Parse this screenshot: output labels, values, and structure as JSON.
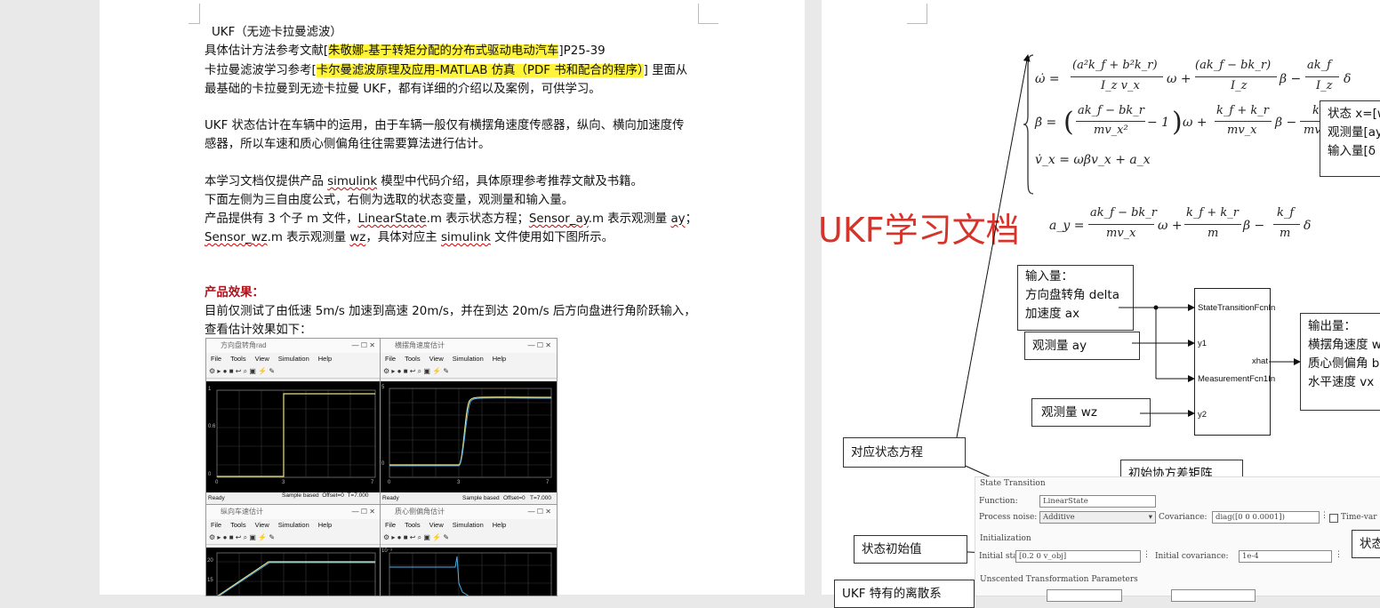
{
  "left_page": {
    "lines": {
      "l1": "UKF（无迹卡拉曼滤波）",
      "l2a": "具体估计方法参考文献[",
      "l2b": "朱敬娜-基于转矩分配的分布式驱动电动汽车",
      "l2c": "]P25-39",
      "l3a": "卡拉曼滤波学习参考[",
      "l3b": "卡尔曼滤波原理及应用-MATLAB 仿真（PDF 书和配合的程序）",
      "l3c": "] 里面从",
      "l4": "最基础的卡拉曼到无迹卡拉曼 UKF，都有详细的介绍以及案例，可供学习。",
      "l5": "UKF 状态估计在车辆中的运用，由于车辆一般仅有横摆角速度传感器，纵向、横向加速度传",
      "l6": "感器，所以车速和质心侧偏角往往需要算法进行估计。",
      "l7a": "本学习文档仅提供产品 ",
      "l7b": "simulink",
      "l7c": " 模型中代码介绍，具体原理参考推荐文献及书籍。",
      "l8": "下面左侧为三自由度公式，右侧为选取的状态变量，观测量和输入量。",
      "l9a": "产品提供有 3 个子 m 文件，",
      "l9b": "LinearState",
      "l9c": ".m 表示状态方程；",
      "l9d": "Sensor_ay",
      "l9e": ".m 表示观测量 ",
      "l9f": "ay",
      "l9g": "；",
      "l10a": "Sensor_wz",
      "l10b": ".m 表示观测量 ",
      "l10c": "wz",
      "l10d": "，具体对应主 ",
      "l10e": "simulink",
      "l10f": " 文件使用如下图所示。",
      "l11": "产品效果：",
      "l12": "目前仅测试了由低速 5m/s 加速到高速 20m/s，并在到达 20m/s 后方向盘进行角阶跃输入，",
      "l13": "查看估计效果如下："
    },
    "windows": [
      {
        "title": "方向盘转角rad",
        "status": "Ready",
        "sample": "Sample based",
        "offset": "Offset=0",
        "time": "T=7.000"
      },
      {
        "title": "横摆角速度估计",
        "status": "Ready",
        "sample": "Sample based",
        "offset": "Offset=0",
        "time": "T=7.000"
      },
      {
        "title": "纵向车速估计"
      },
      {
        "title": "质心侧偏角估计"
      }
    ],
    "menu": [
      "File",
      "Tools",
      "View",
      "Simulation",
      "Help"
    ],
    "w1_yticks": [
      "1",
      "0.8",
      "0.6",
      "0.4",
      "0.2",
      "0"
    ],
    "w1_xticks": [
      "0",
      "1",
      "2",
      "3",
      "4",
      "5",
      "6",
      "7"
    ],
    "w2_yticks": [
      "5",
      "4",
      "3",
      "2",
      "1",
      "0",
      "-1"
    ],
    "w2_xticks": [
      "0",
      "1",
      "2",
      "3",
      "4",
      "5",
      "6",
      "7"
    ],
    "w3_yticks": [
      "20",
      "15",
      "10"
    ],
    "w4_exp": "10⁻³"
  },
  "right_page": {
    "watermark": "UKF学习文档",
    "eq": {
      "omega_lhs": "ω̇ =",
      "omega_f1_num": "(a²k_f + b²k_r)",
      "omega_f1_den": "I_z v_x",
      "omega_m1": "ω +",
      "omega_f2_num": "(ak_f − bk_r)",
      "omega_f2_den": "I_z",
      "omega_m2": "β −",
      "omega_f3_num": "ak_f",
      "omega_f3_den": "I_z",
      "omega_end": "δ",
      "beta_lhs": "β̇ =",
      "beta_paren": "( ak_f − bk_r / mv_x² − 1 )",
      "beta_f1_num": "ak_f − bk_r",
      "beta_f1_den": "mv_x²",
      "beta_minus1": "− 1",
      "beta_m1": "ω +",
      "beta_f2_num": "k_f + k_r",
      "beta_f2_den": "mv_x",
      "beta_m2": "β −",
      "beta_f3_num": "k_f",
      "beta_f3_den": "mv_x",
      "beta_end": "δ",
      "vx_line": "v̇_x = ωβv_x + a_x",
      "ay_lhs": "a_y =",
      "ay_f1_num": "ak_f − bk_r",
      "ay_f1_den": "mv_x",
      "ay_m1": "ω +",
      "ay_f2_num": "k_f + k_r",
      "ay_f2_den": "m",
      "ay_m2": "β −",
      "ay_f3_num": "k_f",
      "ay_f3_den": "m",
      "ay_end": "δ"
    },
    "state_box": [
      "状态 x=[w",
      "观测量[ay",
      "输入量[δ"
    ],
    "input_box": [
      "输入量：",
      "方向盘转角 delta",
      "加速度 ax"
    ],
    "obs_ay": "观测量 ay",
    "obs_wz": "观测量 wz",
    "block_ports": {
      "p1": "StateTransitionFcnIn",
      "p2": "y1",
      "p3": "MeasurementFcn1In",
      "p4": "y2",
      "out": "xhat"
    },
    "output_box": [
      "输出量：",
      "横摆角速度 w",
      "质心侧偏角 b",
      "水平速度 vx"
    ],
    "annot_state_eq": "对应状态方程",
    "annot_init_cov": "初始协方差矩阵",
    "annot_init_val": "状态初始值",
    "annot_state_right": "状态",
    "annot_ukf": "UKF 特有的离散系",
    "dialog": {
      "section1": "State Transition",
      "function_label": "Function:",
      "function_value": "LinearState",
      "noise_label": "Process noise:",
      "noise_value": "Additive",
      "cov_label": "Covariance:",
      "cov_value": "diag([0 0 0.0001])",
      "timevar": "Time-var",
      "section2": "Initialization",
      "init_state_label": "Initial state:",
      "init_state_value": "[0.2 0 v_obj]",
      "init_cov_label": "Initial covariance:",
      "init_cov_value": "1e-4",
      "section3": "Unscented Transformation Parameters"
    }
  }
}
